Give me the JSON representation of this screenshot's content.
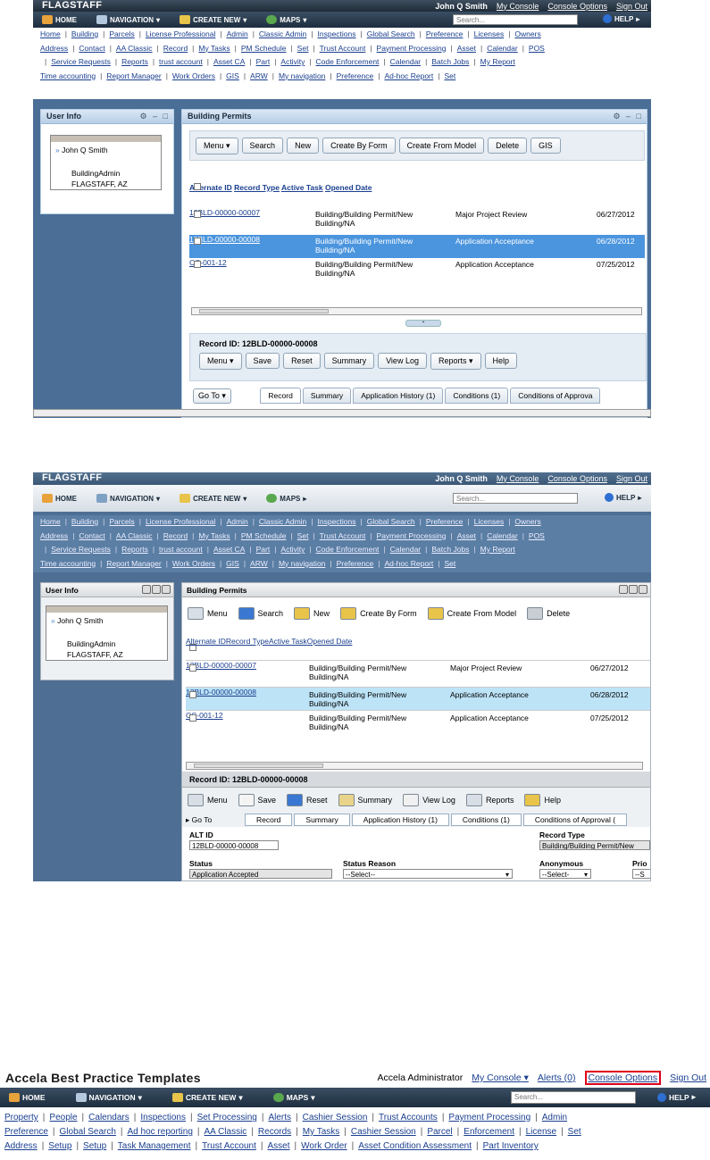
{
  "s1": {
    "brand": "FLAGSTAFF",
    "user": "John Q Smith",
    "my_console": "My Console",
    "console_options": "Console Options",
    "sign_out": "Sign Out",
    "menu": {
      "home": "HOME",
      "navigation": "NAVIGATION",
      "create_new": "CREATE NEW",
      "maps": "MAPS",
      "search_placeholder": "Search...",
      "help": "HELP"
    },
    "tabs": [
      [
        "Home",
        "Building",
        "Parcels",
        "License Professional",
        "Admin",
        "Classic Admin",
        "Inspections",
        "Global Search",
        "Preference",
        "Licenses",
        "Owners"
      ],
      [
        "Address",
        "Contact",
        "AA Classic",
        "Record",
        "My Tasks",
        "PM Schedule",
        "Set",
        "Trust Account",
        "Payment Processing",
        "Asset",
        "Calendar",
        "POS"
      ],
      [
        "Service Requests",
        "Reports",
        "trust account",
        "Asset CA",
        "Part",
        "Activity",
        "Code Enforcement",
        "Calendar",
        "Batch Jobs",
        "My Report"
      ],
      [
        "Time accounting",
        "Report Manager",
        "Work Orders",
        "GIS",
        "ARW",
        "My navigation",
        "Preference",
        "Ad-hoc Report",
        "Set"
      ]
    ],
    "user_info": {
      "title": "User Info",
      "name": "John Q Smith",
      "role": "BuildingAdmin",
      "location": "FLAGSTAFF, AZ"
    },
    "permits": {
      "title": "Building Permits",
      "buttons": [
        "Menu",
        "Search",
        "New",
        "Create By Form",
        "Create From Model",
        "Delete",
        "GIS"
      ],
      "columns": [
        "Alternate ID",
        "Record Type",
        "Active Task",
        "Opened Date"
      ],
      "rows": [
        {
          "id": "12BLD-00000-00007",
          "type": "Building/Building Permit/New Building/NA",
          "task": "Major Project Review",
          "date": "06/27/2012"
        },
        {
          "id": "12BLD-00000-00008",
          "type": "Building/Building Permit/New Building/NA",
          "task": "Application Acceptance",
          "date": "06/28/2012"
        },
        {
          "id": "CC-001-12",
          "type": "Building/Building Permit/New Building/NA",
          "task": "Application Acceptance",
          "date": "07/25/2012"
        }
      ]
    },
    "record": {
      "title": "Record ID: 12BLD-00000-00008",
      "buttons": [
        "Menu",
        "Save",
        "Reset",
        "Summary",
        "View Log",
        "Reports",
        "Help"
      ],
      "goto": "Go To",
      "subtabs": [
        "Record",
        "Summary",
        "Application History (1)",
        "Conditions (1)",
        "Conditions of Approva"
      ]
    }
  },
  "s2": {
    "brand": "FLAGSTAFF",
    "user": "John Q Smith",
    "my_console": "My Console",
    "console_options": "Console Options",
    "sign_out": "Sign Out",
    "menu": {
      "home": "HOME",
      "navigation": "NAVIGATION",
      "create_new": "CREATE NEW",
      "maps": "MAPS",
      "search_placeholder": "Search...",
      "help": "HELP"
    },
    "user_info": {
      "title": "User Info",
      "name": "John Q Smith",
      "role": "BuildingAdmin",
      "location": "FLAGSTAFF, AZ"
    },
    "permits_title": "Building Permits",
    "toolbar": [
      "Menu",
      "Search",
      "New",
      "Create By Form",
      "Create From Model",
      "Delete"
    ],
    "record_title": "Record ID: 12BLD-00000-00008",
    "record_toolbar": [
      "Menu",
      "Save",
      "Reset",
      "Summary",
      "View Log",
      "Reports",
      "Help"
    ],
    "goto": "Go To",
    "subtabs": [
      "Record",
      "Summary",
      "Application History (1)",
      "Conditions (1)",
      "Conditions of Approval ("
    ],
    "form": {
      "alt_id_label": "ALT ID",
      "alt_id": "12BLD-00000-00008",
      "record_type_label": "Record Type",
      "record_type": "Building/Building Permit/New",
      "status_label": "Status",
      "status": "Application Accepted",
      "status_reason_label": "Status Reason",
      "status_reason": "--Select--",
      "anonymous_label": "Anonymous",
      "anonymous": "--Select-",
      "priority_label": "Prio",
      "priority": "--S"
    }
  },
  "s3": {
    "brand": "Accela Best Practice Templates",
    "user": "Accela Administrator",
    "my_console": "My Console",
    "alerts": "Alerts (0)",
    "console_options": "Console Options",
    "sign_out": "Sign Out",
    "menu": {
      "home": "HOME",
      "navigation": "NAVIGATION",
      "create_new": "CREATE NEW",
      "maps": "MAPS",
      "search_placeholder": "Search...",
      "help": "HELP"
    },
    "tabs": [
      [
        "Property",
        "People",
        "Calendars",
        "Inspections",
        "Set Processing",
        "Alerts",
        "Cashier Session",
        "Trust Accounts",
        "Payment Processing",
        "Admin"
      ],
      [
        "Preference",
        "Global Search",
        "Ad hoc reporting",
        "AA Classic",
        "Records",
        "My Tasks",
        "Cashier Session",
        "Parcel",
        "Enforcement",
        "License",
        "Set"
      ],
      [
        "Address",
        "Setup",
        "Setup",
        "Task Management",
        "Trust Account",
        "Asset",
        "Work Order",
        "Asset Condition Assessment",
        "Part Inventory"
      ]
    ]
  }
}
